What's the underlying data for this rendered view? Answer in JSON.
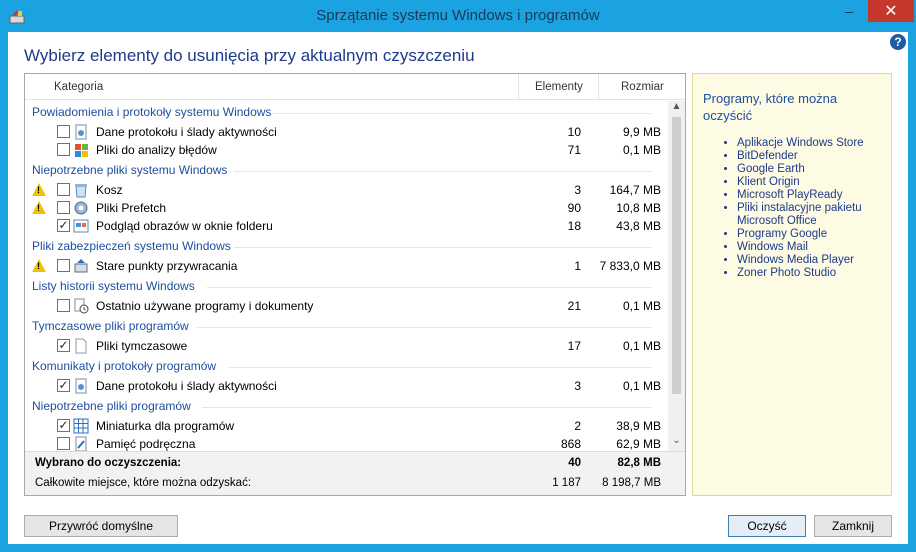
{
  "window": {
    "title": "Sprzątanie systemu Windows i programów",
    "accent": "#1aa3e0",
    "controls": {
      "minimize": "–",
      "maximize": "□",
      "close": "✕"
    }
  },
  "heading": "Wybierz elementy do usunięcia przy aktualnym czyszczeniu",
  "help": "?",
  "table": {
    "headers": {
      "category": "Kategoria",
      "elements": "Elementy",
      "size": "Rozmiar"
    },
    "groups": [
      {
        "label": "Powiadomienia i protokoły systemu Windows"
      },
      {
        "label": "Niepotrzebne pliki systemu Windows"
      },
      {
        "label": "Pliki zabezpieczeń systemu Windows"
      },
      {
        "label": "Listy historii systemu Windows"
      },
      {
        "label": "Tymczasowe pliki programów"
      },
      {
        "label": "Komunikaty i protokoły programów"
      },
      {
        "label": "Niepotrzebne pliki programów"
      }
    ],
    "items": [
      {
        "label": "Dane protokołu i ślady aktywności",
        "count": "10",
        "size": "9,9 MB",
        "checked": false,
        "warning": false,
        "icon": "gear-document-icon"
      },
      {
        "label": "Pliki do analizy błędów",
        "count": "71",
        "size": "0,1 MB",
        "checked": false,
        "warning": false,
        "icon": "windows-flag-icon"
      },
      {
        "label": "Kosz",
        "count": "3",
        "size": "164,7 MB",
        "checked": false,
        "warning": true,
        "icon": "recycle-bin-icon"
      },
      {
        "label": "Pliki Prefetch",
        "count": "90",
        "size": "10,8 MB",
        "checked": false,
        "warning": true,
        "icon": "gear-icon"
      },
      {
        "label": "Podgląd obrazów w oknie folderu",
        "count": "18",
        "size": "43,8 MB",
        "checked": true,
        "warning": false,
        "icon": "thumbnail-icon"
      },
      {
        "label": "Stare punkty przywracania",
        "count": "1",
        "size": "7 833,0 MB",
        "checked": false,
        "warning": true,
        "icon": "restore-point-icon"
      },
      {
        "label": "Ostatnio używane programy i dokumenty",
        "count": "21",
        "size": "0,1 MB",
        "checked": false,
        "warning": false,
        "icon": "clock-document-icon"
      },
      {
        "label": "Pliki tymczasowe",
        "count": "17",
        "size": "0,1 MB",
        "checked": true,
        "warning": false,
        "icon": "blank-file-icon"
      },
      {
        "label": "Dane protokołu i ślady aktywności",
        "count": "3",
        "size": "0,1 MB",
        "checked": true,
        "warning": false,
        "icon": "gear-document-icon"
      },
      {
        "label": "Miniaturka dla programów",
        "count": "2",
        "size": "38,9 MB",
        "checked": true,
        "warning": false,
        "icon": "grid-icon"
      },
      {
        "label": "Pamięć podręczna",
        "count": "868",
        "size": "62,9 MB",
        "checked": false,
        "warning": false,
        "icon": "cache-document-icon"
      }
    ],
    "summary": {
      "selected_label": "Wybrano do oczyszczenia:",
      "selected_count": "40",
      "selected_size": "82,8 MB",
      "total_label": "Całkowite miejsce, które można odzyskać:",
      "total_count": "1 187",
      "total_size": "8 198,7 MB"
    }
  },
  "sidebar": {
    "title": "Programy, które można oczyścić",
    "programs": [
      "Aplikacje Windows Store",
      "BitDefender",
      "Google Earth",
      "Klient Origin",
      "Microsoft PlayReady",
      "Pliki instalacyjne pakietu Microsoft Office",
      "Programy Google",
      "Windows Mail",
      "Windows Media Player",
      "Zoner Photo Studio"
    ]
  },
  "buttons": {
    "restore": "Przywróć domyślne",
    "clean": "Oczyść",
    "close": "Zamknij"
  }
}
